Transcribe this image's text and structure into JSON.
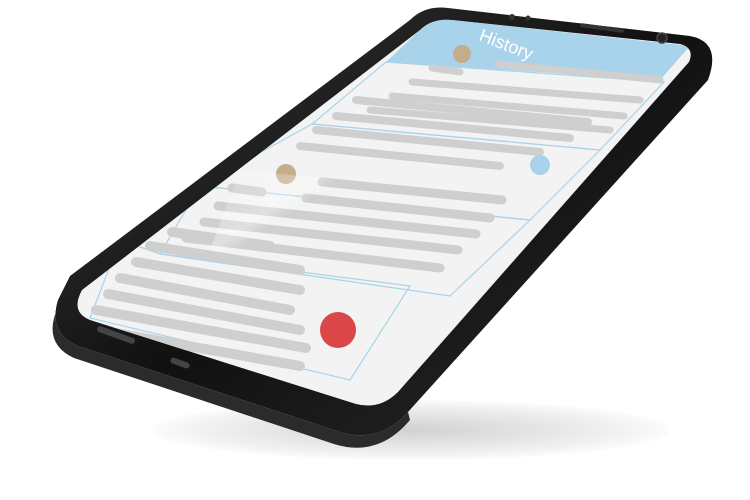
{
  "app": {
    "title": "History"
  },
  "colors": {
    "header_bg": "#a9d3ea",
    "screen_bg": "#f3f3f3",
    "card_border": "#a9d3ea",
    "placeholder_bar": "#cfcfcf",
    "phone_body": "#1a1a1a",
    "dot_tan": "#c4ad8a",
    "dot_blue": "#a9d3ea",
    "dot_red": "#d9474a"
  },
  "history_items": [
    {
      "status_dot": "tan"
    },
    {
      "status_dot": "blue"
    },
    {
      "status_dot": "tan"
    },
    {
      "status_dot": "red"
    }
  ]
}
